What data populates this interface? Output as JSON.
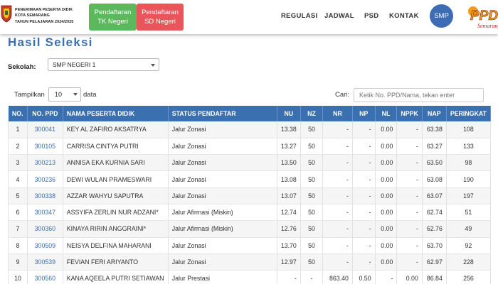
{
  "header": {
    "brand_lines": [
      "PENERIMAAN PESERTA DIDIK",
      "KOTA SEMARANG",
      "TAHUN PELAJARAN 2024/2025"
    ],
    "btn_tk": [
      "Pendaftaran",
      "TK Negeri"
    ],
    "btn_sd": [
      "Pendaftaran",
      "SD Negeri"
    ],
    "nav": [
      "REGULASI",
      "JADWAL",
      "PSD",
      "KONTAK"
    ],
    "smp_badge": "SMP",
    "logo_text": "PPD",
    "logo_sub": "Semarang",
    "colors": {
      "tk": "#5cb85c",
      "sd": "#e9555a",
      "badge": "#3d6cb5",
      "accent": "#3a6fb0"
    }
  },
  "main": {
    "title": "Hasil Seleksi",
    "sekolah_label": "Sekolah:",
    "sekolah_value": "SMP NEGERI 1",
    "show_label": "Tampilkan",
    "entries_value": "10",
    "data_label": "data",
    "search_label": "Cari:",
    "search_placeholder": "Ketik No. PPD/Nama, tekan enter"
  },
  "table": {
    "columns": [
      "NO.",
      "NO. PPD",
      "NAMA PESERTA DIDIK",
      "STATUS PENDAFTAR",
      "NU",
      "NZ",
      "NR",
      "NP",
      "NL",
      "NPPK",
      "NAP",
      "PERINGKAT"
    ],
    "rows": [
      [
        "1",
        "300041",
        "KEY AL ZAFIRO AKSATRYA",
        "Jalur Zonasi",
        "13.38",
        "50",
        "-",
        "-",
        "0.00",
        "-",
        "63.38",
        "108"
      ],
      [
        "2",
        "300105",
        "CARRISA CINTYA PUTRI",
        "Jalur Zonasi",
        "13.27",
        "50",
        "-",
        "-",
        "0.00",
        "-",
        "63.27",
        "133"
      ],
      [
        "3",
        "300213",
        "ANNISA EKA KURNIA SARI",
        "Jalur Zonasi",
        "13.50",
        "50",
        "-",
        "-",
        "0.00",
        "-",
        "63.50",
        "98"
      ],
      [
        "4",
        "300236",
        "DEWI WULAN PRAMESWARI",
        "Jalur Zonasi",
        "13.08",
        "50",
        "-",
        "-",
        "0.00",
        "-",
        "63.08",
        "190"
      ],
      [
        "5",
        "300338",
        "AZZAR WAHYU SAPUTRA",
        "Jalur Zonasi",
        "13.07",
        "50",
        "-",
        "-",
        "0.00",
        "-",
        "63.07",
        "197"
      ],
      [
        "6",
        "300347",
        "ASSYIFA ZERLIN NUR ADZANI*",
        "Jalur Afirmasi (Miskin)",
        "12.74",
        "50",
        "-",
        "-",
        "0.00",
        "-",
        "62.74",
        "51"
      ],
      [
        "7",
        "300360",
        "KINAYA RIRIN ANGGRAINI*",
        "Jalur Afirmasi (Miskin)",
        "12.76",
        "50",
        "-",
        "-",
        "0.00",
        "-",
        "62.76",
        "49"
      ],
      [
        "8",
        "300509",
        "NEISYA DELFINA MAHARANI",
        "Jalur Zonasi",
        "13.70",
        "50",
        "-",
        "-",
        "0.00",
        "-",
        "63.70",
        "92"
      ],
      [
        "9",
        "300539",
        "FEVIAN FERI ARIYANTO",
        "Jalur Zonasi",
        "12.97",
        "50",
        "-",
        "-",
        "0.00",
        "-",
        "62.97",
        "228"
      ],
      [
        "10",
        "300560",
        "KANA AQEELA PUTRI SETIAWAN",
        "Jalur Prestasi",
        "-",
        "-",
        "863.40",
        "0.50",
        "-",
        "0.00",
        "86.84",
        "256"
      ]
    ]
  }
}
